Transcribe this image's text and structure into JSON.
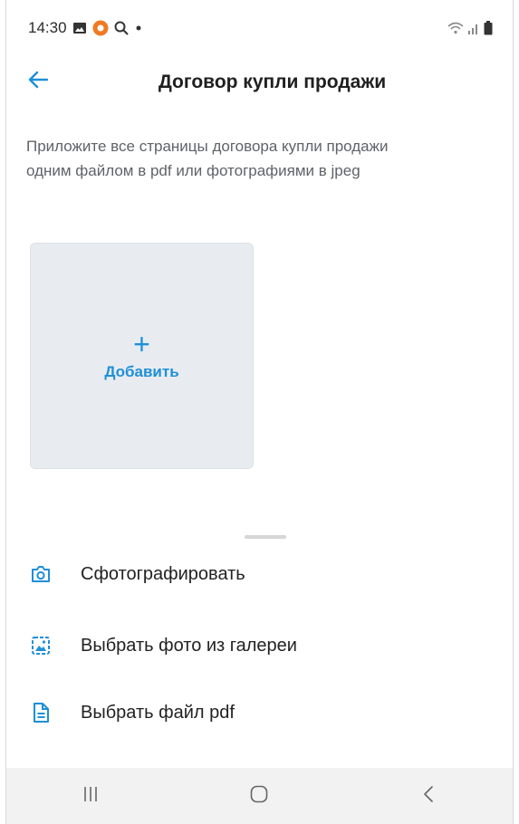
{
  "status_bar": {
    "time": "14:30",
    "icons_left": [
      "gallery-icon",
      "app-notification-icon",
      "search-icon",
      "dot-icon"
    ],
    "icons_right": [
      "wifi-icon",
      "signal-icon",
      "battery-icon"
    ]
  },
  "header": {
    "back_icon": "arrow-left-icon",
    "title": "Договор купли продажи"
  },
  "description": "Приложите все страницы договора купли продажи одним файлом в pdf или фотографиями в jpeg",
  "add_tile": {
    "plus": "+",
    "label": "Добавить"
  },
  "sheet": {
    "items": [
      {
        "icon": "camera-icon",
        "label": "Сфотографировать"
      },
      {
        "icon": "gallery-image-icon",
        "label": "Выбрать фото из галереи"
      },
      {
        "icon": "document-icon",
        "label": "Выбрать файл pdf"
      }
    ]
  },
  "nav_bar": {
    "buttons": [
      "recent-apps-icon",
      "home-icon",
      "back-icon"
    ]
  },
  "colors": {
    "accent": "#1e8fd8",
    "tile_bg": "#e8ecf0",
    "nav_bg": "#f2f2f2"
  }
}
